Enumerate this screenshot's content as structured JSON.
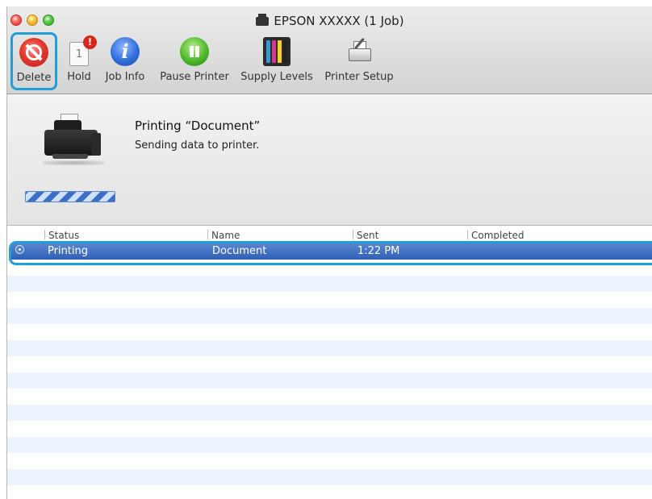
{
  "window": {
    "title": "EPSON XXXXX (1 Job)"
  },
  "toolbar": {
    "delete_label": "Delete",
    "hold_label": "Hold",
    "hold_page_number": "1",
    "hold_badge": "!",
    "job_info_label": "Job Info",
    "job_info_glyph": "i",
    "pause_label": "Pause Printer",
    "supply_label": "Supply Levels",
    "setup_label": "Printer Setup"
  },
  "status": {
    "heading": "Printing “Document”",
    "message": "Sending data to printer."
  },
  "table": {
    "columns": [
      "Status",
      "Name",
      "Sent",
      "Completed"
    ],
    "rows": [
      {
        "status": "Printing",
        "name": "Document",
        "sent": "1:22 PM",
        "completed": ""
      }
    ]
  },
  "colors": {
    "highlight_outline": "#1f9ed8",
    "selection": "#2f5fb5",
    "row_stripe": "#edf3fe",
    "ink": [
      "#2f9bd8",
      "#d23b8a",
      "#f2d22e",
      "#222222"
    ]
  },
  "icons": {
    "delete": "no-entry-icon",
    "hold": "page-with-badge-icon",
    "job_info": "info-icon",
    "pause": "pause-icon",
    "supply": "ink-cartridges-icon",
    "setup": "printer-wrench-icon",
    "printer": "printer-icon",
    "job_status": "printing-status-icon"
  }
}
